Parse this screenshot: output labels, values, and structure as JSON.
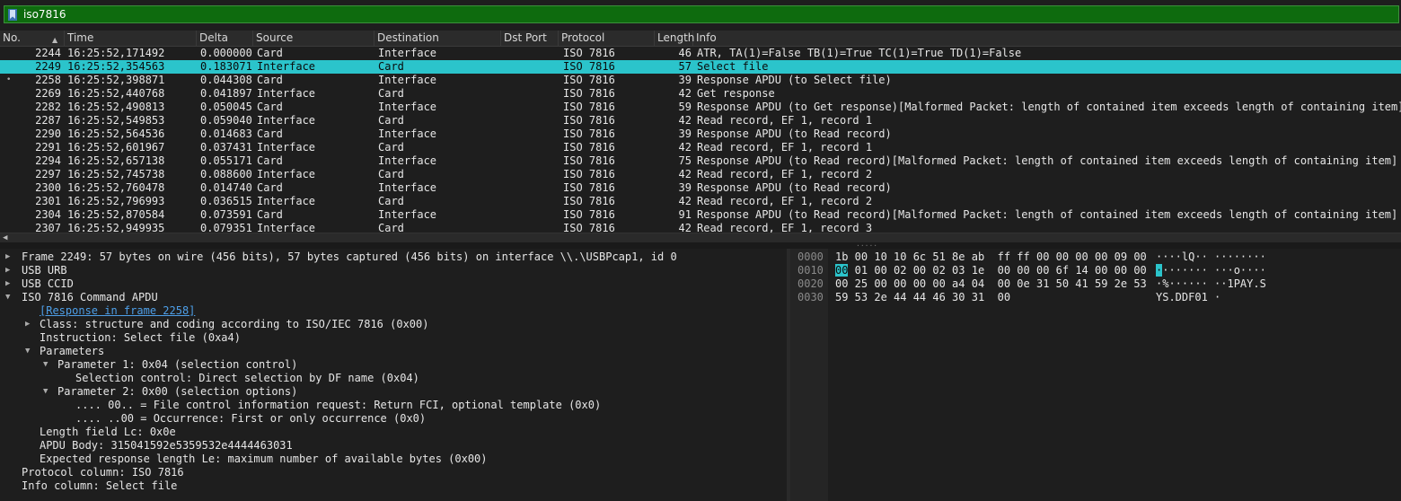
{
  "filter": {
    "text": "iso7816",
    "icon": "bookmark-icon",
    "bg_color": "#0e6b0e"
  },
  "columns": [
    "No.",
    "Time",
    "Delta",
    "Source",
    "Destination",
    "Dst Port",
    "Protocol",
    "Length",
    "Info"
  ],
  "packets": [
    {
      "no": "2244",
      "time": "16:25:52,171492",
      "delta": "0.000000",
      "source": "Card",
      "destination": "Interface",
      "protocol": "ISO 7816",
      "length": "46",
      "info": "ATR, TA(1)=False TB(1)=True TC(1)=True TD(1)=False",
      "selected": false
    },
    {
      "no": "2249",
      "time": "16:25:52,354563",
      "delta": "0.183071",
      "source": "Interface",
      "destination": "Card",
      "protocol": "ISO 7816",
      "length": "57",
      "info": "Select file",
      "selected": true
    },
    {
      "no": "2258",
      "time": "16:25:52,398871",
      "delta": "0.044308",
      "source": "Card",
      "destination": "Interface",
      "protocol": "ISO 7816",
      "length": "39",
      "info": "Response APDU (to Select file)",
      "selected": false,
      "marker": "•"
    },
    {
      "no": "2269",
      "time": "16:25:52,440768",
      "delta": "0.041897",
      "source": "Interface",
      "destination": "Card",
      "protocol": "ISO 7816",
      "length": "42",
      "info": "Get response",
      "selected": false
    },
    {
      "no": "2282",
      "time": "16:25:52,490813",
      "delta": "0.050045",
      "source": "Card",
      "destination": "Interface",
      "protocol": "ISO 7816",
      "length": "59",
      "info": "Response APDU (to Get response)[Malformed Packet: length of contained item exceeds length of containing item]",
      "selected": false
    },
    {
      "no": "2287",
      "time": "16:25:52,549853",
      "delta": "0.059040",
      "source": "Interface",
      "destination": "Card",
      "protocol": "ISO 7816",
      "length": "42",
      "info": "Read record, EF 1, record 1",
      "selected": false
    },
    {
      "no": "2290",
      "time": "16:25:52,564536",
      "delta": "0.014683",
      "source": "Card",
      "destination": "Interface",
      "protocol": "ISO 7816",
      "length": "39",
      "info": "Response APDU (to Read record)",
      "selected": false
    },
    {
      "no": "2291",
      "time": "16:25:52,601967",
      "delta": "0.037431",
      "source": "Interface",
      "destination": "Card",
      "protocol": "ISO 7816",
      "length": "42",
      "info": "Read record, EF 1, record 1",
      "selected": false
    },
    {
      "no": "2294",
      "time": "16:25:52,657138",
      "delta": "0.055171",
      "source": "Card",
      "destination": "Interface",
      "protocol": "ISO 7816",
      "length": "75",
      "info": "Response APDU (to Read record)[Malformed Packet: length of contained item exceeds length of containing item]",
      "selected": false
    },
    {
      "no": "2297",
      "time": "16:25:52,745738",
      "delta": "0.088600",
      "source": "Interface",
      "destination": "Card",
      "protocol": "ISO 7816",
      "length": "42",
      "info": "Read record, EF 1, record 2",
      "selected": false
    },
    {
      "no": "2300",
      "time": "16:25:52,760478",
      "delta": "0.014740",
      "source": "Card",
      "destination": "Interface",
      "protocol": "ISO 7816",
      "length": "39",
      "info": "Response APDU (to Read record)",
      "selected": false
    },
    {
      "no": "2301",
      "time": "16:25:52,796993",
      "delta": "0.036515",
      "source": "Interface",
      "destination": "Card",
      "protocol": "ISO 7816",
      "length": "42",
      "info": "Read record, EF 1, record 2",
      "selected": false
    },
    {
      "no": "2304",
      "time": "16:25:52,870584",
      "delta": "0.073591",
      "source": "Card",
      "destination": "Interface",
      "protocol": "ISO 7816",
      "length": "91",
      "info": "Response APDU (to Read record)[Malformed Packet: length of contained item exceeds length of containing item]",
      "selected": false
    },
    {
      "no": "2307",
      "time": "16:25:52,949935",
      "delta": "0.079351",
      "source": "Interface",
      "destination": "Card",
      "protocol": "ISO 7816",
      "length": "42",
      "info": "Read record, EF 1, record 3",
      "selected": false
    }
  ],
  "details": [
    {
      "text": "Frame 2249: 57 bytes on wire (456 bits), 57 bytes captured (456 bits) on interface \\\\.\\USBPcap1, id 0",
      "level": 0,
      "expander": "collapsed"
    },
    {
      "text": "USB URB",
      "level": 0,
      "expander": "collapsed"
    },
    {
      "text": "USB CCID",
      "level": 0,
      "expander": "collapsed"
    },
    {
      "text": "ISO 7816 Command APDU",
      "level": 0,
      "expander": "expanded"
    },
    {
      "text": "[Response in frame 2258]",
      "level": 1,
      "expander": "none",
      "link": true
    },
    {
      "text": "Class: structure and coding according to ISO/IEC 7816 (0x00)",
      "level": 1,
      "expander": "collapsed"
    },
    {
      "text": "Instruction: Select file (0xa4)",
      "level": 1,
      "expander": "none"
    },
    {
      "text": "Parameters",
      "level": 1,
      "expander": "expanded"
    },
    {
      "text": "Parameter 1: 0x04 (selection control)",
      "level": 2,
      "expander": "expanded"
    },
    {
      "text": "Selection control: Direct selection by DF name (0x04)",
      "level": 3,
      "expander": "none"
    },
    {
      "text": "Parameter 2: 0x00 (selection options)",
      "level": 2,
      "expander": "expanded"
    },
    {
      "text": ".... 00.. = File control information request: Return FCI, optional template (0x0)",
      "level": 3,
      "expander": "none"
    },
    {
      "text": ".... ..00 = Occurrence: First or only occurrence (0x0)",
      "level": 3,
      "expander": "none"
    },
    {
      "text": "Length field Lc: 0x0e",
      "level": 1,
      "expander": "none"
    },
    {
      "text": "APDU Body: 315041592e5359532e4444463031",
      "level": 1,
      "expander": "none"
    },
    {
      "text": "Expected response length Le: maximum number of available bytes (0x00)",
      "level": 1,
      "expander": "none"
    },
    {
      "text": "Protocol column: ISO 7816",
      "level": 0,
      "expander": "none"
    },
    {
      "text": "Info column: Select file",
      "level": 0,
      "expander": "none"
    }
  ],
  "bytes": [
    {
      "offset": "0000",
      "hex_pre": "",
      "hex_hl": "",
      "hex_post": "1b 00 10 10 6c 51 8e ab  ff ff 00 00 00 00 09 00",
      "ascii_pre": "",
      "ascii_hl": "",
      "ascii_post": "····lQ·· ········"
    },
    {
      "offset": "0010",
      "hex_pre": "",
      "hex_hl": "00",
      "hex_post": " 01 00 02 00 02 03 1e  00 00 00 6f 14 00 00 00",
      "ascii_pre": "",
      "ascii_hl": "·",
      "ascii_post": "······· ···o····"
    },
    {
      "offset": "0020",
      "hex_pre": "",
      "hex_hl": "",
      "hex_post": "00 25 00 00 00 00 a4 04  00 0e 31 50 41 59 2e 53",
      "ascii_pre": "",
      "ascii_hl": "",
      "ascii_post": "·%······ ··1PAY.S"
    },
    {
      "offset": "0030",
      "hex_pre": "",
      "hex_hl": "",
      "hex_post": "59 53 2e 44 44 46 30 31  00",
      "ascii_pre": "",
      "ascii_hl": "",
      "ascii_post": "YS.DDF01 ·"
    }
  ],
  "colors": {
    "selected_row": "#2bc4cb",
    "link": "#4e9fe8",
    "filter_ok": "#0e6b0e"
  }
}
